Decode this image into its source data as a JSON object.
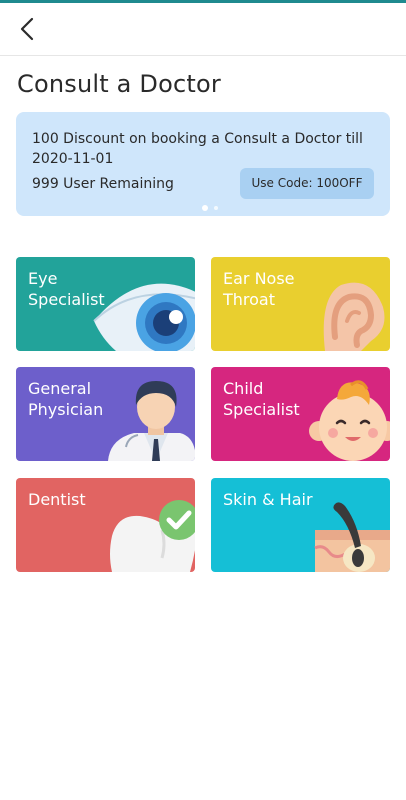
{
  "header": {
    "title": "Consult a Doctor"
  },
  "promo": {
    "text": "100 Discount on booking a Consult a Doctor till 2020-11-01",
    "remaining": "999 User Remaining",
    "code_button": "Use Code: 100OFF",
    "slide_count": 2,
    "active_slide": 1
  },
  "categories": [
    {
      "label": "Eye Specialist",
      "color": "#22a39a",
      "icon": "eye-icon"
    },
    {
      "label": "Ear Nose Throat",
      "color": "#e9cf2f",
      "icon": "ear-icon"
    },
    {
      "label": "General Physician",
      "color": "#6d5fcb",
      "icon": "doctor-icon"
    },
    {
      "label": "Child Specialist",
      "color": "#d6267f",
      "icon": "baby-icon"
    },
    {
      "label": "Dentist",
      "color": "#e16462",
      "icon": "tooth-icon"
    },
    {
      "label": "Skin & Hair",
      "color": "#15bfd6",
      "icon": "skin-hair-icon"
    }
  ],
  "colors": {
    "accent": "#1f8a8f",
    "promo_bg": "#cfe6fb",
    "promo_button_bg": "#a9d0f2"
  }
}
